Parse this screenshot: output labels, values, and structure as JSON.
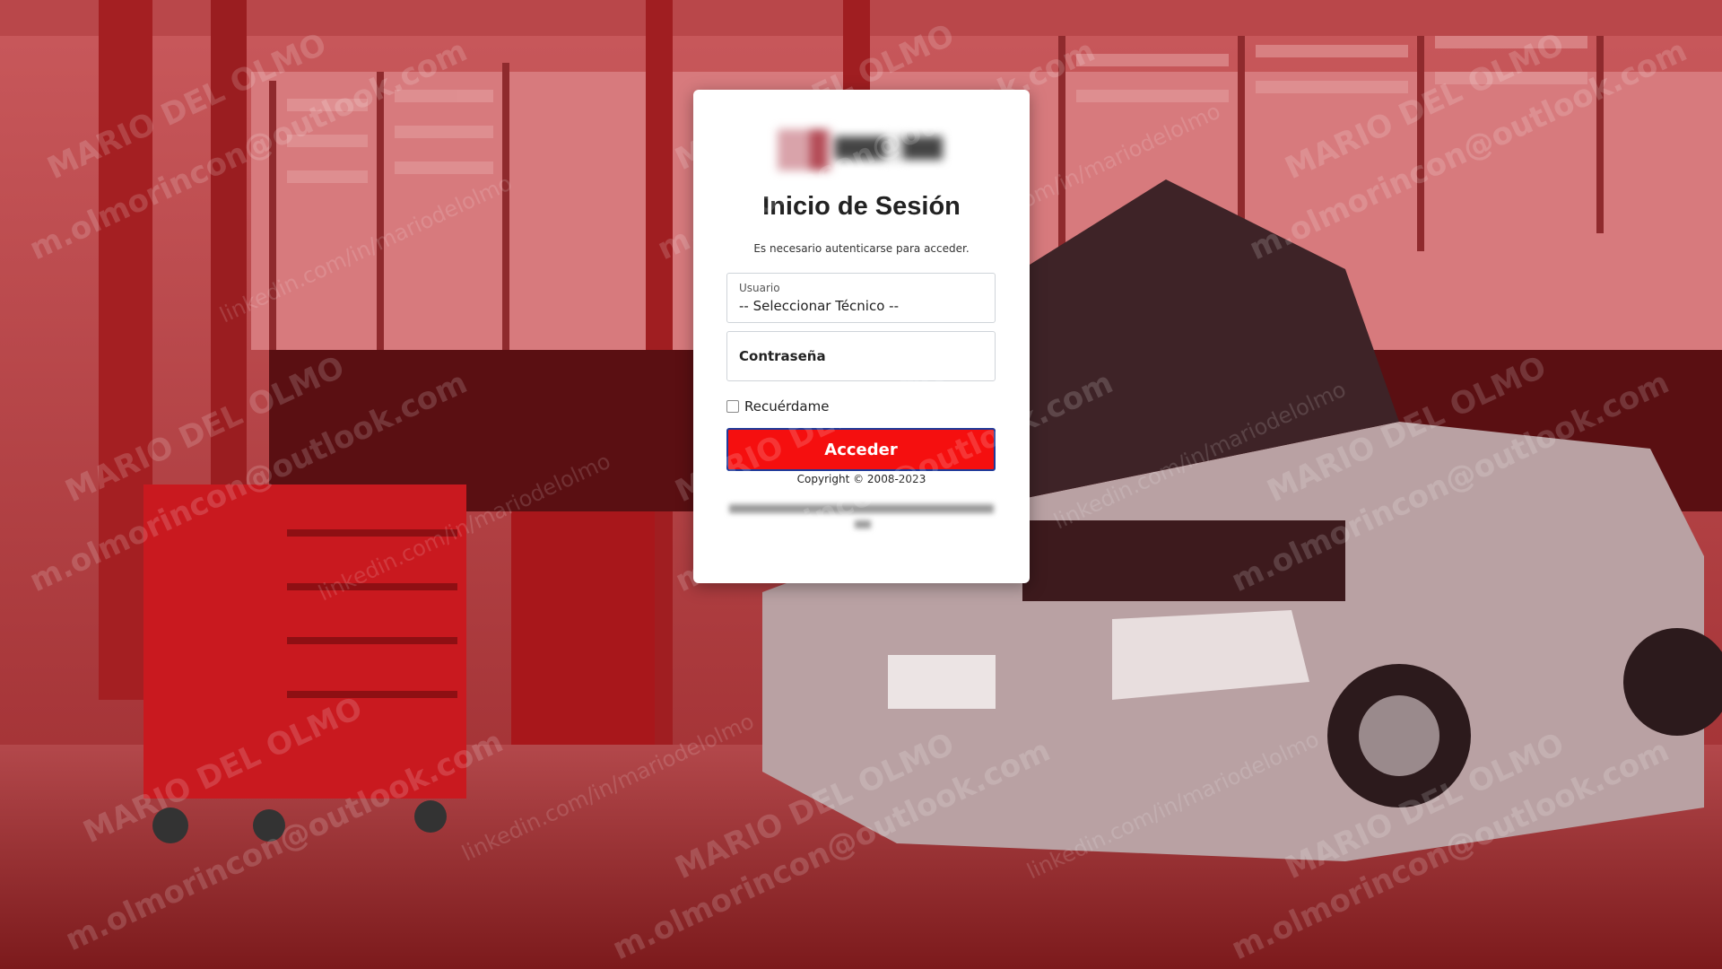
{
  "login": {
    "title": "Inicio de Sesión",
    "subtitle": "Es necesario autenticarse para acceder.",
    "username_label": "Usuario",
    "username_value": "-- Seleccionar Técnico --",
    "password_label": "Contraseña",
    "remember_label": "Recuérdame",
    "remember_checked": false,
    "submit_label": "Acceder",
    "copyright": "Copyright © 2008-2023"
  },
  "watermark": {
    "name": "MARIO DEL OLMO",
    "email": "m.olmorincon@outlook.com",
    "linkedin": "linkedin.com/in/mariodelolmo"
  },
  "colors": {
    "accent": "#f50f0f",
    "button_border": "#1f3a9a",
    "background_tint": "#8a1c1c"
  }
}
